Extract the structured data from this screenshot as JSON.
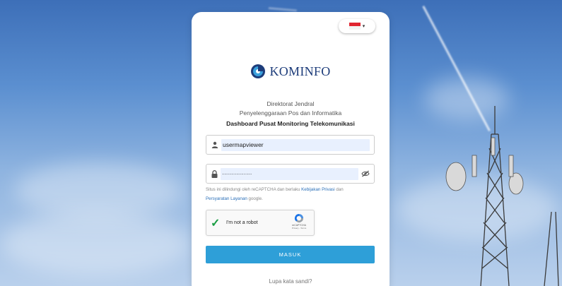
{
  "language": {
    "flag": "id-flag-icon",
    "caret": "▾"
  },
  "brand": {
    "logo_icon": "kominfo-logo-icon",
    "name": "KOMINFO"
  },
  "header": {
    "line1": "Direktorat Jendral",
    "line2": "Penyelenggaraan Pos dan Informatika",
    "title": "Dashboard Pusat Monitoring Telekomunikasi"
  },
  "form": {
    "username": {
      "value": "usermapviewer",
      "icon": "user-icon"
    },
    "password": {
      "value": "···············",
      "icon": "lock-icon",
      "toggle_icon": "eye-off-icon"
    },
    "recaptcha_note": {
      "prefix": "Situs ini dilindungi oleh reCAPTCHA dan berlaku ",
      "privacy_link": "Kebijakan Privasi",
      "middle": " dan",
      "terms_link": "Persyaratan Layanan",
      "suffix": " google."
    },
    "recaptcha": {
      "label": "I'm not a robot",
      "brand": "reCAPTCHA",
      "links": "Privacy - Terms",
      "checked": true
    },
    "submit_label": "MASUK",
    "forgot_label": "Lupa kata sandi?"
  },
  "colors": {
    "primary": "#2e9fd8",
    "brand": "#1d3c7a",
    "link": "#2a6fb8",
    "check": "#1b9e44"
  }
}
